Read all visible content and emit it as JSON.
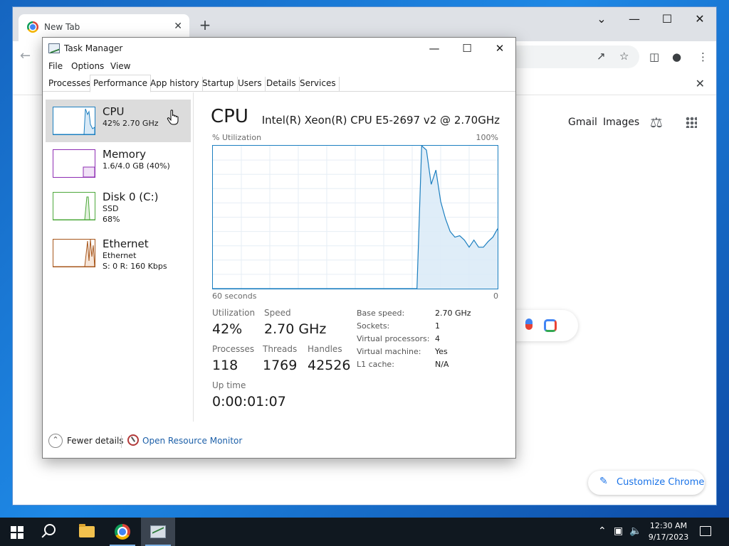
{
  "browser": {
    "tab_title": "New Tab",
    "tab_close": "✕",
    "new_tab": "+",
    "links": [
      "Gmail",
      "Images"
    ],
    "customize_label": "Customize Chrome"
  },
  "task_manager": {
    "title": "Task Manager",
    "menu": [
      "File",
      "Options",
      "View"
    ],
    "tabs": [
      "Processes",
      "Performance",
      "App history",
      "Startup",
      "Users",
      "Details",
      "Services"
    ],
    "active_tab": "Performance",
    "sidebar": [
      {
        "name": "CPU",
        "sub1": "42% 2.70 GHz",
        "sub2": "",
        "color": "#1c7fc0"
      },
      {
        "name": "Memory",
        "sub1": "1.6/4.0 GB (40%)",
        "sub2": "",
        "color": "#8e2db3"
      },
      {
        "name": "Disk 0 (C:)",
        "sub1": "SSD",
        "sub2": "68%",
        "color": "#4da83b"
      },
      {
        "name": "Ethernet",
        "sub1": "Ethernet",
        "sub2": "S: 0 R: 160 Kbps",
        "color": "#a7561b"
      }
    ],
    "main": {
      "heading": "CPU",
      "model": "Intel(R) Xeon(R) CPU E5-2697 v2 @ 2.70GHz",
      "y_label": "% Utilization",
      "y_max_label": "100%",
      "x_left_label": "60 seconds",
      "x_right_label": "0",
      "stats": {
        "utilization_label": "Utilization",
        "utilization": "42%",
        "speed_label": "Speed",
        "speed": "2.70 GHz",
        "processes_label": "Processes",
        "processes": "118",
        "threads_label": "Threads",
        "threads": "1769",
        "handles_label": "Handles",
        "handles": "42526",
        "uptime_label": "Up time",
        "uptime": "0:00:01:07"
      },
      "properties": [
        {
          "label": "Base speed:",
          "value": "2.70 GHz"
        },
        {
          "label": "Sockets:",
          "value": "1"
        },
        {
          "label": "Virtual processors:",
          "value": "4"
        },
        {
          "label": "Virtual machine:",
          "value": "Yes"
        },
        {
          "label": "L1 cache:",
          "value": "N/A"
        }
      ]
    },
    "footer": {
      "fewer_details": "Fewer details",
      "open_resmon": "Open Resource Monitor"
    }
  },
  "chart_data": {
    "type": "area",
    "x_range": [
      60,
      0
    ],
    "ylim": [
      0,
      100
    ],
    "x": [
      60,
      59,
      58,
      57,
      56,
      55,
      54,
      53,
      52,
      51,
      50,
      49,
      48,
      47,
      46,
      45,
      44,
      43,
      42,
      41,
      40,
      39,
      38,
      37,
      36,
      35,
      34,
      33,
      32,
      31,
      30,
      29,
      28,
      27,
      26,
      25,
      24,
      23,
      22,
      21,
      20,
      19,
      18,
      17,
      16,
      15,
      14,
      13,
      12,
      11,
      10,
      9,
      8,
      7,
      6,
      5,
      4,
      3,
      2,
      1,
      0
    ],
    "values": [
      0,
      0,
      0,
      0,
      0,
      0,
      0,
      0,
      0,
      0,
      0,
      0,
      0,
      0,
      0,
      0,
      0,
      0,
      0,
      0,
      0,
      0,
      0,
      0,
      0,
      0,
      0,
      0,
      0,
      0,
      0,
      0,
      0,
      0,
      0,
      0,
      0,
      0,
      0,
      0,
      0,
      0,
      0,
      0,
      100,
      97,
      73,
      83,
      61,
      49,
      40,
      36,
      37,
      34,
      29,
      34,
      29,
      29,
      33,
      36,
      42
    ],
    "grid": true,
    "color": "#1c7fc0"
  },
  "taskbar": {
    "time": "12:30 AM",
    "date": "9/17/2023"
  }
}
